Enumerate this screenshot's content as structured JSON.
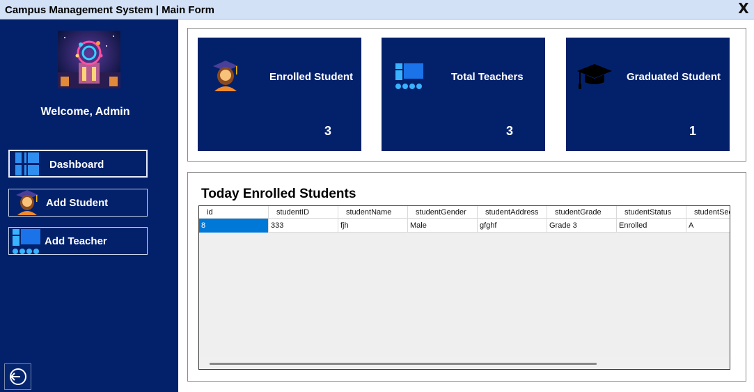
{
  "window": {
    "title": "Campus Management System | Main Form",
    "close_label": "X"
  },
  "sidebar": {
    "welcome": "Welcome, Admin",
    "nav": [
      {
        "label": "Dashboard",
        "icon": "dashboard-icon"
      },
      {
        "label": "Add Student",
        "icon": "student-icon"
      },
      {
        "label": "Add Teacher",
        "icon": "teacher-icon"
      }
    ],
    "logout_icon": "logout-icon"
  },
  "stats": [
    {
      "title": "Enrolled Student",
      "value": "3",
      "icon": "student-icon"
    },
    {
      "title": "Total Teachers",
      "value": "3",
      "icon": "teacher-icon"
    },
    {
      "title": "Graduated Student",
      "value": "1",
      "icon": "graduation-cap-icon"
    }
  ],
  "table": {
    "title": "Today Enrolled Students",
    "columns": [
      "id",
      "studentID",
      "studentName",
      "studentGender",
      "studentAddress",
      "studentGrade",
      "studentStatus",
      "studentSec"
    ],
    "rows": [
      [
        "8",
        "333",
        "fjh",
        "Male",
        "gfghf",
        "Grade 3",
        "Enrolled",
        "A"
      ]
    ]
  },
  "colors": {
    "sidebar": "#03216b",
    "card": "#03216b",
    "titlebar": "#d3e1f7",
    "selection": "#0078d7"
  }
}
